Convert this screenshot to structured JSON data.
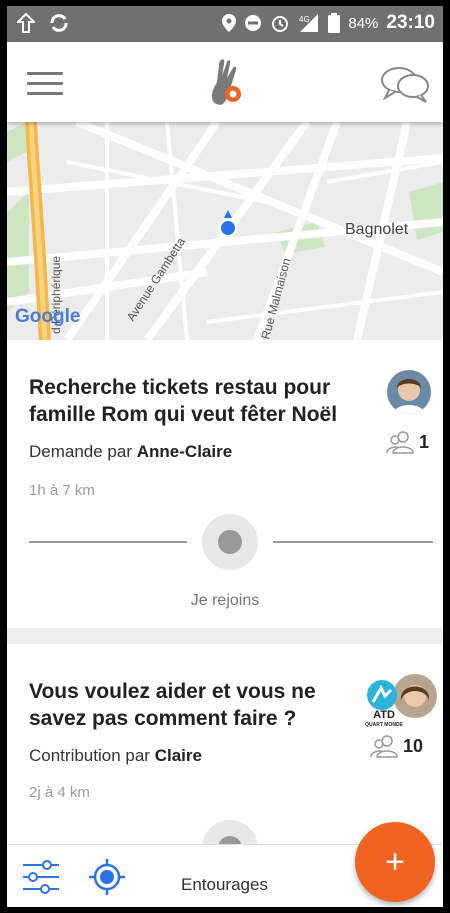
{
  "status_bar": {
    "battery": "84%",
    "time": "23:10",
    "network": "4G"
  },
  "header": {
    "menu_icon": "hamburger-icon",
    "logo_icon": "entourage-hand-logo",
    "messages_icon": "chat-bubbles-icon"
  },
  "map": {
    "labels": {
      "area": "Bagnolet",
      "street1": "Avenue Gambetta",
      "street2": "Rue Malmaison",
      "ring": "d Périphérique",
      "brand": "Google"
    }
  },
  "cards": [
    {
      "title": "Recherche tickets restau pour famille Rom qui veut fêter Noël",
      "byline_prefix": "Demande par",
      "author": "Anne-Claire",
      "meta": "1h à 7 km",
      "members": "1",
      "join_label": "Je rejoins"
    },
    {
      "title": "Vous voulez aider et vous ne savez pas comment faire ?",
      "byline_prefix": "Contribution par",
      "author": "Claire",
      "meta": "2j à 4 km",
      "members": "10",
      "badge": "ATD",
      "badge_sub": "QUART MONDE"
    }
  ],
  "bottom_bar": {
    "tab_label": "Entourages",
    "fab_label": "+"
  },
  "colors": {
    "accent": "#f06321",
    "location": "#2a73e8",
    "statusbar": "#707070"
  }
}
